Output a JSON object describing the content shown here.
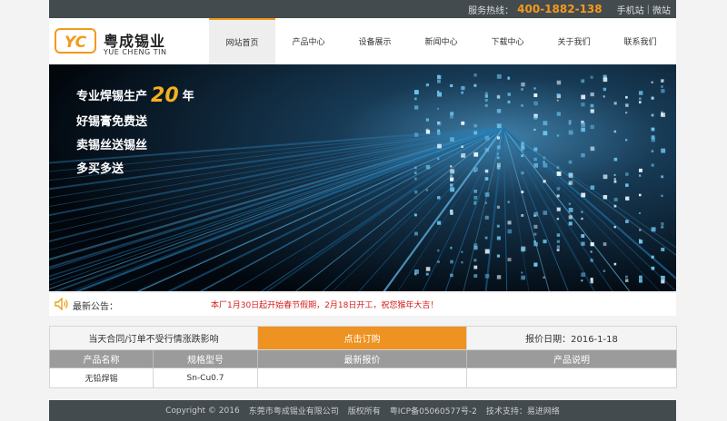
{
  "topbar": {
    "hotline_label": "服务热线：",
    "hotline": "400-1882-138",
    "mobile_link": "手机站",
    "separator": "|",
    "wechat_link": "微站"
  },
  "brand": {
    "name_cn": "粤成锡业",
    "name_en": "YUE CHENG TIN",
    "logo_text": "YC",
    "logo_color": "#f39a1b"
  },
  "nav": {
    "items": [
      {
        "label": "网站首页",
        "active": true
      },
      {
        "label": "产品中心"
      },
      {
        "label": "设备展示"
      },
      {
        "label": "新闻中心"
      },
      {
        "label": "下载中心"
      },
      {
        "label": "关于我们"
      },
      {
        "label": "联系我们"
      }
    ]
  },
  "banner": {
    "line1_prefix": "专业焊锡生产",
    "line1_number": "20",
    "line1_suffix": "年",
    "line2": "好锡膏免费送",
    "line3": "卖锡丝送锡丝",
    "line4": "多买多送"
  },
  "notice": {
    "label": "最新公告：",
    "text": "本厂1月30日起开始春节假期，2月18日开工，祝您猴年大吉！",
    "text_color": "#d51b1b"
  },
  "price_table": {
    "left_note": "当天合同/订单不受行情涨跌影响",
    "order_button": "点击订购",
    "quote_date": "报价日期：2016-1-18",
    "headers": [
      "产品名称",
      "规格型号",
      "最新报价",
      "产品说明"
    ],
    "rows": [
      [
        "无铅焊锡",
        "Sn-Cu0.7",
        "",
        ""
      ]
    ],
    "accent": "#ee9222"
  },
  "footer": {
    "copyright": "Copyright © 2016",
    "company": "东莞市粤成锡业有限公司",
    "rights": "版权所有",
    "icp": "粤ICP备05060577号-2",
    "support": "技术支持：易进网络"
  }
}
